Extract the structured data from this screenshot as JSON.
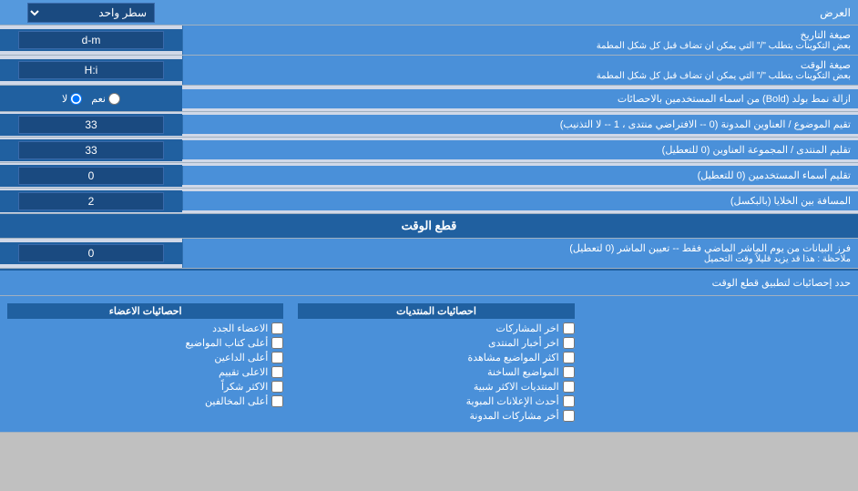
{
  "header": {
    "display_label": "العرض",
    "display_select_label": "سطر واحد"
  },
  "rows": [
    {
      "id": "date_format",
      "label": "صيغة التاريخ\nبعض التكوينات يتطلب \"/\" التي يمكن ان تضاف قبل كل شكل المطمة",
      "value": "d-m",
      "type": "text"
    },
    {
      "id": "time_format",
      "label": "صيغة الوقت\nبعض التكوينات يتطلب \"/\" التي يمكن ان تضاف قبل كل شكل المطمة",
      "value": "H:i",
      "type": "text"
    },
    {
      "id": "bold_remove",
      "label": "ازالة نمط بولد (Bold) من اسماء المستخدمين بالاحصائات",
      "type": "radio",
      "options": [
        "نعم",
        "لا"
      ],
      "selected": "لا"
    },
    {
      "id": "topic_order",
      "label": "تقيم الموضوع / العناوين المدونة (0 -- الافتراضي منتدى ، 1 -- لا التذنيب)",
      "value": "33",
      "type": "text"
    },
    {
      "id": "forum_order",
      "label": "تقليم المنتدى / المجموعة العناوين (0 للتعطيل)",
      "value": "33",
      "type": "text"
    },
    {
      "id": "user_names",
      "label": "تقليم أسماء المستخدمين (0 للتعطيل)",
      "value": "0",
      "type": "text"
    },
    {
      "id": "cell_spacing",
      "label": "المسافة بين الخلايا (بالبكسل)",
      "value": "2",
      "type": "text"
    }
  ],
  "time_cut_section": {
    "header": "قطع الوقت",
    "row": {
      "label": "فرز البيانات من يوم الماشر الماضي فقط -- تعيين الماشر (0 لتعطيل)\nملاحظة : هذا قد يزيد قليلاً وقت التحميل",
      "value": "0"
    }
  },
  "stats_section": {
    "apply_label": "حدد إحصائيات لتطبيق قطع الوقت",
    "col1_header": "احصائيات المنتديات",
    "col1_items": [
      "اخر المشاركات",
      "اخر أخبار المنتدى",
      "اكثر المواضيع مشاهدة",
      "المواضيع الساخنة",
      "المنتديات الاكثر شبية",
      "أحدث الإعلانات المبوية",
      "أخر مشاركات المدونة"
    ],
    "col2_header": "احصائيات الاعضاء",
    "col2_items": [
      "الاعضاء الجدد",
      "أعلى كتاب المواضيع",
      "أعلى الداعين",
      "الاعلى تقييم",
      "الاكثر شكراً",
      "أعلى المخالفين"
    ]
  }
}
